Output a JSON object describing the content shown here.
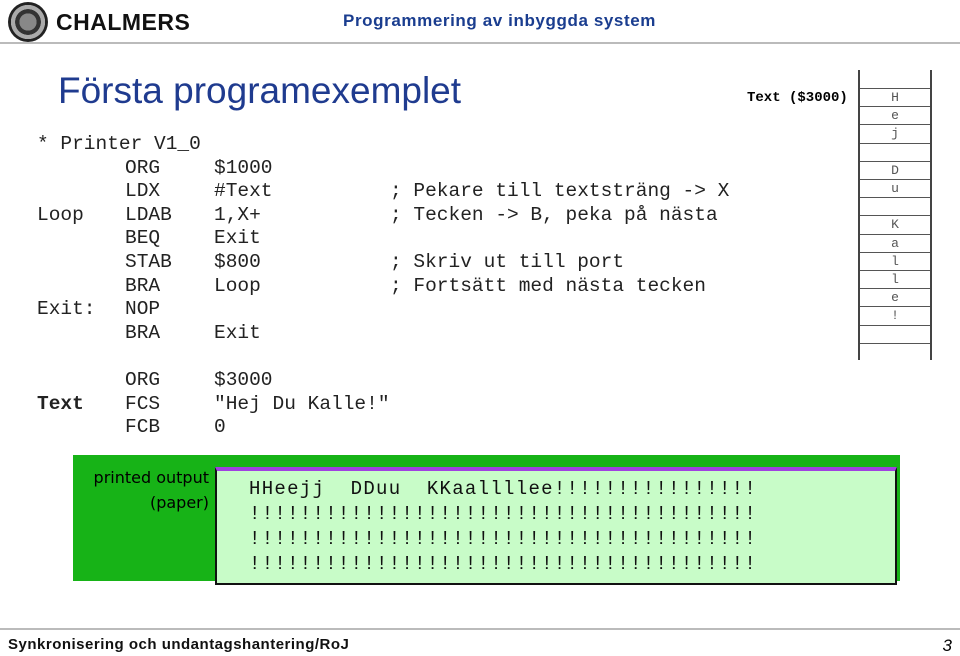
{
  "header": {
    "logo_text": "CHALMERS",
    "course": "Programmering av inbyggda system"
  },
  "title": "Första programexemplet",
  "code": [
    {
      "label": "* Printer V1_0",
      "op": "",
      "arg": "",
      "comment": ""
    },
    {
      "label": "",
      "op": "ORG",
      "arg": "$1000",
      "comment": ""
    },
    {
      "label": "",
      "op": "LDX",
      "arg": "#Text",
      "comment": "; Pekare till textsträng -> X"
    },
    {
      "label": "Loop",
      "op": "LDAB",
      "arg": "1,X+",
      "comment": "; Tecken -> B, peka på nästa"
    },
    {
      "label": "",
      "op": "BEQ",
      "arg": "Exit",
      "comment": ""
    },
    {
      "label": "",
      "op": "STAB",
      "arg": "$800",
      "comment": "; Skriv ut till port"
    },
    {
      "label": "",
      "op": "BRA",
      "arg": "Loop",
      "comment": "; Fortsätt med nästa tecken"
    },
    {
      "label": "Exit:",
      "op": "NOP",
      "arg": "",
      "comment": ""
    },
    {
      "label": "",
      "op": "BRA",
      "arg": "Exit",
      "comment": ""
    },
    {
      "label": "",
      "op": "",
      "arg": "",
      "comment": ""
    },
    {
      "label": "",
      "op": "ORG",
      "arg": "$3000",
      "comment": ""
    },
    {
      "label": "Text",
      "op": "FCS",
      "arg": "\"Hej Du Kalle!\"",
      "comment": ""
    },
    {
      "label": "",
      "op": "FCB",
      "arg": "0",
      "comment": ""
    }
  ],
  "memory": {
    "label": "Text ($3000)",
    "cells": [
      "H",
      "e",
      "j",
      "",
      "D",
      "u",
      "",
      "K",
      "a",
      "l",
      "l",
      "e",
      "!",
      ""
    ]
  },
  "printer": {
    "label_line1": "printed output",
    "label_line2": "(paper)",
    "lines": [
      "HHeejj  DDuu  KKaallllee!!!!!!!!!!!!!!!!",
      "!!!!!!!!!!!!!!!!!!!!!!!!!!!!!!!!!!!!!!!!",
      "!!!!!!!!!!!!!!!!!!!!!!!!!!!!!!!!!!!!!!!!",
      "!!!!!!!!!!!!!!!!!!!!!!!!!!!!!!!!!!!!!!!!"
    ]
  },
  "footer": {
    "text": "Synkronisering och undantagshantering/RoJ",
    "page": "3"
  }
}
